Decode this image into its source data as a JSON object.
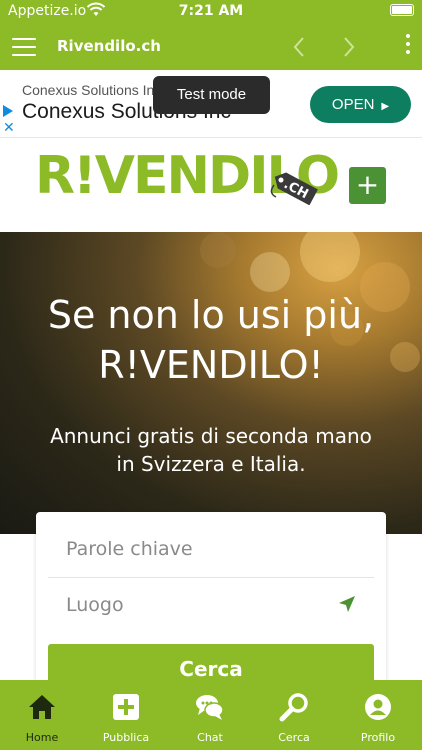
{
  "status_bar": {
    "carrier": "Appetize.io",
    "time": "7:21 AM"
  },
  "app_bar": {
    "title": "Rivendilo.ch",
    "menu_icon": "hamburger-icon",
    "back_icon": "chevron-left-icon",
    "forward_icon": "chevron-right-icon",
    "more_icon": "kebab-menu-icon"
  },
  "ad": {
    "company_small": "Conexus Solutions In",
    "company_big": "Conexus Solutions Inc",
    "button_label": "OPEN",
    "toast": "Test mode"
  },
  "logo": {
    "text": "R!VENDILO",
    "tag": ".CH",
    "add_icon": "plus-icon"
  },
  "hero": {
    "title_line1": "Se non lo usi più,",
    "title_line2": "R!VENDILO!",
    "subtitle": "Annunci gratis di seconda mano in Svizzera e Italia."
  },
  "search": {
    "keywords_placeholder": "Parole chiave",
    "location_placeholder": "Luogo",
    "location_icon": "location-arrow-icon",
    "button_label": "Cerca"
  },
  "bottom_nav": [
    {
      "label": "Home",
      "icon": "home-icon",
      "active": true
    },
    {
      "label": "Pubblica",
      "icon": "plus-square-icon",
      "active": false
    },
    {
      "label": "Chat",
      "icon": "chat-icon",
      "active": false
    },
    {
      "label": "Cerca",
      "icon": "search-icon",
      "active": false
    },
    {
      "label": "Profilo",
      "icon": "user-circle-icon",
      "active": false
    }
  ],
  "colors": {
    "brand_green": "#8dba27",
    "dark_green": "#4a9233",
    "ad_button": "#0d7f60",
    "nav_active": "#1e2a10"
  }
}
